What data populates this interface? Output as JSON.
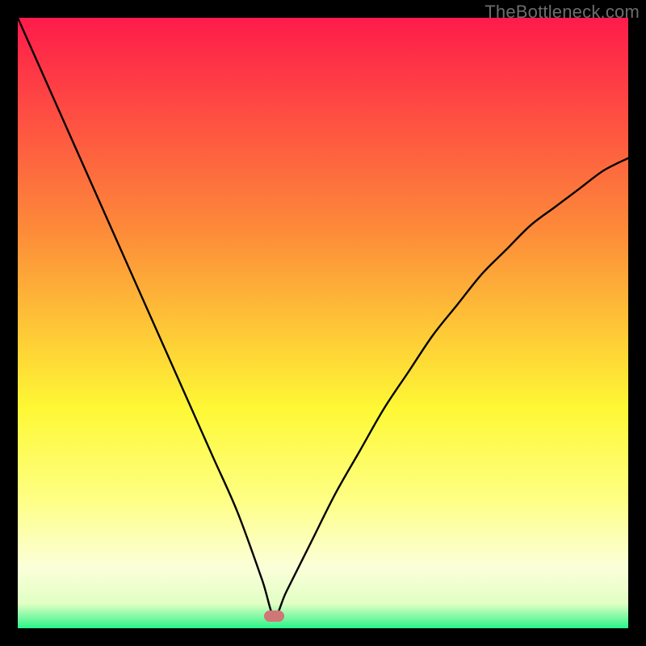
{
  "watermark": "TheBottleneck.com",
  "colors": {
    "top": "#fe1b4a",
    "mid_upper": "#fd8b39",
    "mid": "#fef835",
    "lower_yellow": "#feff85",
    "pale": "#fbffd9",
    "green": "#2af489",
    "frame": "#000000",
    "curve": "#000000",
    "marker": "#cf7777"
  },
  "chart_data": {
    "type": "line",
    "title": "",
    "xlabel": "",
    "ylabel": "",
    "xlim": [
      0,
      100
    ],
    "ylim": [
      0,
      100
    ],
    "annotations": [],
    "marker": {
      "x": 42,
      "y": 2,
      "w": 3.2,
      "h": 1.8
    },
    "gradient_stops": [
      {
        "pos": 0,
        "color": "#fe1b4a"
      },
      {
        "pos": 35,
        "color": "#fd8b39"
      },
      {
        "pos": 64,
        "color": "#fef835"
      },
      {
        "pos": 79,
        "color": "#feff85"
      },
      {
        "pos": 90,
        "color": "#fbffd9"
      },
      {
        "pos": 96,
        "color": "#e1ffc4"
      },
      {
        "pos": 100,
        "color": "#2af489"
      }
    ],
    "series": [
      {
        "name": "bottleneck-curve",
        "x": [
          0,
          4,
          8,
          12,
          16,
          20,
          24,
          28,
          32,
          36,
          40,
          42,
          44,
          48,
          52,
          56,
          60,
          64,
          68,
          72,
          76,
          80,
          84,
          88,
          92,
          96,
          100
        ],
        "y": [
          100,
          91,
          82,
          73,
          64,
          55,
          46,
          37,
          28,
          19,
          8,
          2,
          6,
          14,
          22,
          29,
          36,
          42,
          48,
          53,
          58,
          62,
          66,
          69,
          72,
          75,
          77
        ]
      }
    ]
  }
}
